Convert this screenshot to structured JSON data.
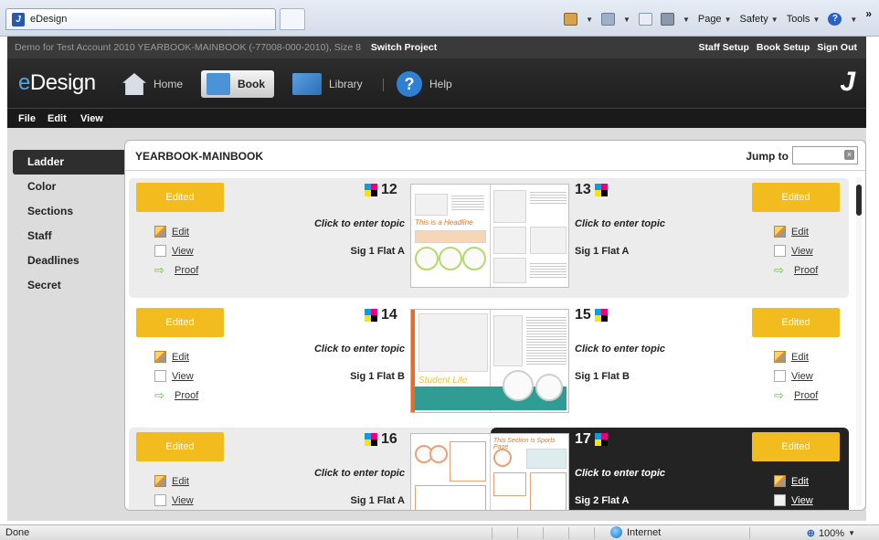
{
  "browser": {
    "tab_title": "eDesign",
    "tools": {
      "page": "Page",
      "safety": "Safety",
      "tools": "Tools",
      "more": "»"
    }
  },
  "header": {
    "project_info": "Demo for Test Account 2010 YEARBOOK-MAINBOOK (-77008-000-2010), Size 8",
    "switch_project": "Switch Project",
    "links": [
      "Staff Setup",
      "Book Setup",
      "Sign Out"
    ],
    "logo_accent": "e",
    "logo_rest": "Design",
    "nav": {
      "home": "Home",
      "book": "Book",
      "library": "Library",
      "help": "Help"
    },
    "menu": [
      "File",
      "Edit",
      "View"
    ]
  },
  "sidebar": {
    "items": [
      "Ladder",
      "Color",
      "Sections",
      "Staff",
      "Deadlines",
      "Secret"
    ],
    "active": "Ladder"
  },
  "panel": {
    "book_name": "YEARBOOK-MAINBOOK",
    "jump_to_label": "Jump to",
    "jump_to_value": ""
  },
  "actions": {
    "edit": "Edit",
    "view": "View",
    "proof": "Proof"
  },
  "spreads": [
    {
      "left": {
        "page": "12",
        "status": "Edited",
        "topic": "Click to enter topic",
        "signature": "Sig 1 Flat A"
      },
      "right": {
        "page": "13",
        "status": "Edited",
        "topic": "Click to enter topic",
        "signature": "Sig 1 Flat A"
      },
      "thumb_title": "This is a Headline"
    },
    {
      "left": {
        "page": "14",
        "status": "Edited",
        "topic": "Click to enter topic",
        "signature": "Sig 1 Flat B"
      },
      "right": {
        "page": "15",
        "status": "Edited",
        "topic": "Click to enter topic",
        "signature": "Sig 1 Flat B"
      },
      "thumb_title": "Student Life"
    },
    {
      "left": {
        "page": "16",
        "status": "Edited",
        "topic": "Click to enter topic",
        "signature": "Sig 1 Flat A"
      },
      "right": {
        "page": "17",
        "status": "Edited",
        "topic": "Click to enter topic",
        "signature": "Sig 2 Flat A"
      },
      "thumb_title": "This Section is Sports Page"
    }
  ],
  "statusbar": {
    "status": "Done",
    "zone": "Internet",
    "zoom": "100%"
  },
  "colors": {
    "edited_badge": "#f2bc1e",
    "logo_accent": "#53a7e6",
    "dark_bar": "#1a1a1a"
  }
}
